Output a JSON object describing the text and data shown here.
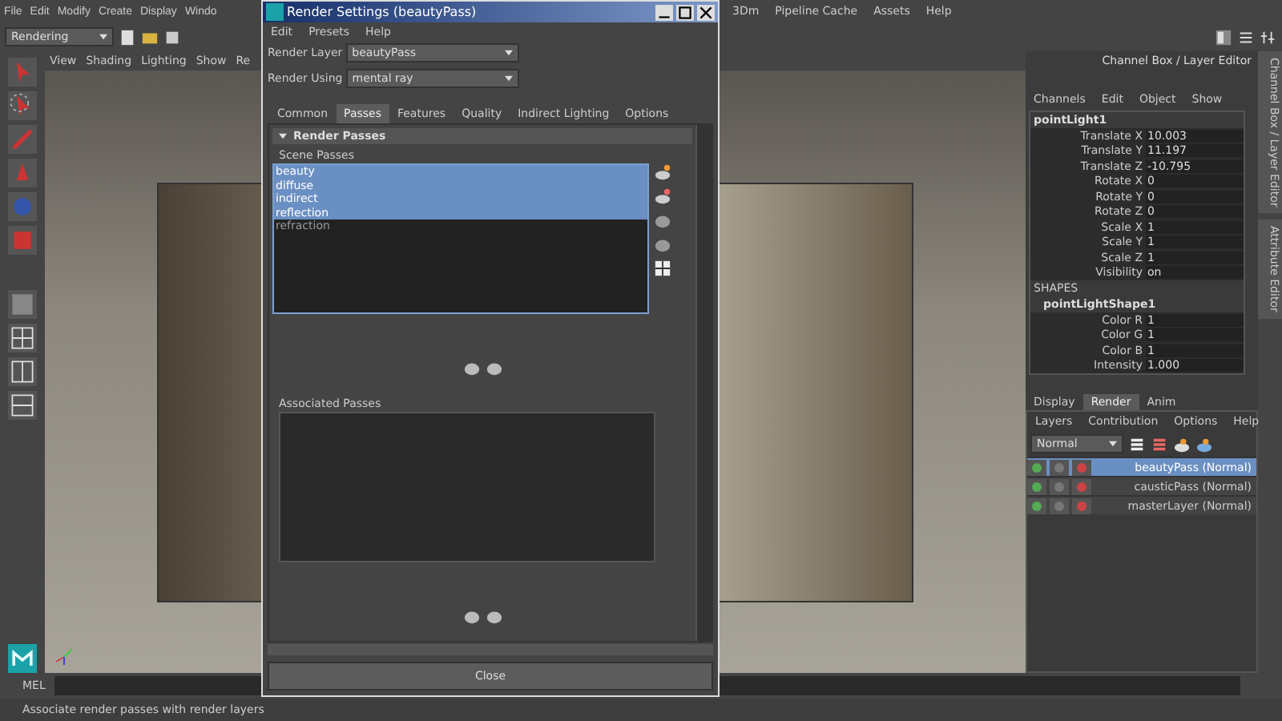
{
  "menu_bar": {
    "left": [
      "File",
      "Edit",
      "Modify",
      "Create",
      "Display",
      "Windo"
    ],
    "right": [
      "3Dm",
      "Pipeline Cache",
      "Assets",
      "Help"
    ]
  },
  "shelf": {
    "mode": "Rendering"
  },
  "viewport": {
    "menus": [
      "View",
      "Shading",
      "Lighting",
      "Show",
      "Re"
    ]
  },
  "render_settings": {
    "title": "Render Settings (beautyPass)",
    "menus": [
      "Edit",
      "Presets",
      "Help"
    ],
    "fields": [
      {
        "label": "Render Layer",
        "value": "beautyPass"
      },
      {
        "label": "Render Using",
        "value": "mental ray"
      }
    ],
    "tabs": [
      {
        "label": "Common",
        "selected": false
      },
      {
        "label": "Passes",
        "selected": true
      },
      {
        "label": "Features",
        "selected": false
      },
      {
        "label": "Quality",
        "selected": false
      },
      {
        "label": "Indirect Lighting",
        "selected": false
      },
      {
        "label": "Options",
        "selected": false
      }
    ],
    "section": "Render Passes",
    "scene_label": "Scene Passes",
    "scene_passes": [
      {
        "name": "beauty",
        "selected": true
      },
      {
        "name": "diffuse",
        "selected": true
      },
      {
        "name": "indirect",
        "selected": true
      },
      {
        "name": "reflection",
        "selected": true
      },
      {
        "name": "refraction",
        "selected": false
      }
    ],
    "associated_label": "Associated Passes",
    "close": "Close"
  },
  "channel_box": {
    "title": "Channel Box / Layer Editor",
    "menus": [
      "Channels",
      "Edit",
      "Object",
      "Show"
    ],
    "object": "pointLight1",
    "attributes": [
      {
        "name": "Translate X",
        "value": "10.003"
      },
      {
        "name": "Translate Y",
        "value": "11.197"
      },
      {
        "name": "Translate Z",
        "value": "-10.795"
      },
      {
        "name": "Rotate X",
        "value": "0"
      },
      {
        "name": "Rotate Y",
        "value": "0"
      },
      {
        "name": "Rotate Z",
        "value": "0"
      },
      {
        "name": "Scale X",
        "value": "1"
      },
      {
        "name": "Scale Y",
        "value": "1"
      },
      {
        "name": "Scale Z",
        "value": "1"
      },
      {
        "name": "Visibility",
        "value": "on"
      }
    ],
    "shapes_label": "SHAPES",
    "shape": "pointLightShape1",
    "shape_attributes": [
      {
        "name": "Color R",
        "value": "1"
      },
      {
        "name": "Color G",
        "value": "1"
      },
      {
        "name": "Color B",
        "value": "1"
      },
      {
        "name": "Intensity",
        "value": "1.000"
      }
    ]
  },
  "side_tabs": [
    "Channel Box / Layer Editor",
    "Attribute Editor"
  ],
  "layer_editor": {
    "tabs": [
      {
        "label": "Display",
        "selected": false
      },
      {
        "label": "Render",
        "selected": true
      },
      {
        "label": "Anim",
        "selected": false
      }
    ],
    "menus": [
      "Layers",
      "Contribution",
      "Options",
      "Help"
    ],
    "blend": "Normal",
    "layers": [
      {
        "name": "beautyPass (Normal)",
        "selected": true
      },
      {
        "name": "causticPass (Normal)",
        "selected": false
      },
      {
        "name": "masterLayer (Normal)",
        "selected": false
      }
    ]
  },
  "command_line": {
    "label": "MEL"
  },
  "help_line": "Associate render passes with render layers"
}
